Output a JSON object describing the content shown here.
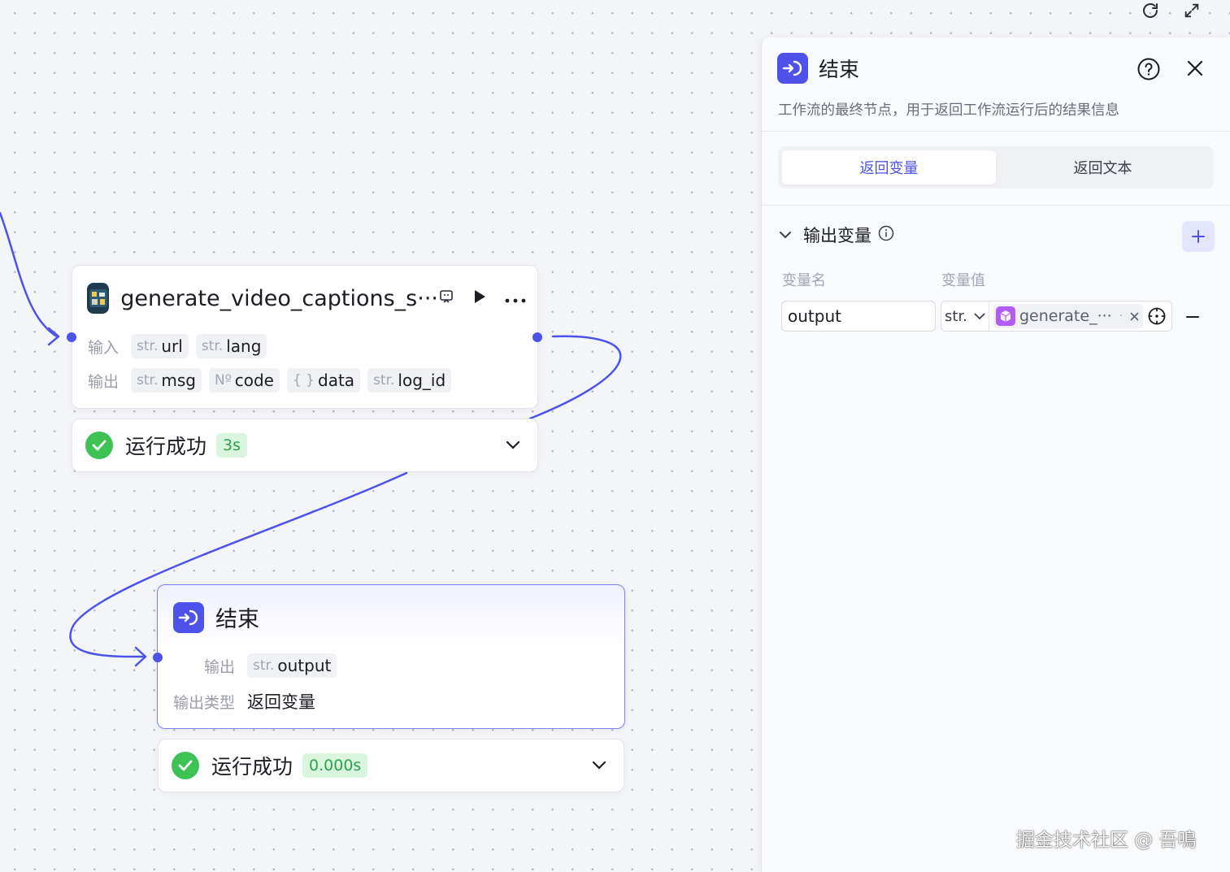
{
  "canvas": {
    "toolbar": {
      "refresh_icon": "refresh-icon",
      "expand_icon": "expand-icon"
    }
  },
  "nodes": {
    "plugin": {
      "title": "generate_video_captions_s···",
      "input_label": "输入",
      "output_label": "输出",
      "inputs": [
        {
          "type": "str.",
          "name": "url"
        },
        {
          "type": "str.",
          "name": "lang"
        }
      ],
      "outputs": [
        {
          "type": "str.",
          "name": "msg"
        },
        {
          "type": "Nº",
          "name": "code"
        },
        {
          "type": "{ }",
          "name": "data"
        },
        {
          "type": "str.",
          "name": "log_id"
        }
      ],
      "status": {
        "text": "运行成功",
        "duration": "3s"
      }
    },
    "end": {
      "title": "结束",
      "output_label": "输出",
      "outputs": [
        {
          "type": "str.",
          "name": "output"
        }
      ],
      "output_type_label": "输出类型",
      "output_type_value": "返回变量",
      "status": {
        "text": "运行成功",
        "duration": "0.000s"
      }
    }
  },
  "panel": {
    "title": "结束",
    "description": "工作流的最终节点，用于返回工作流运行后的结果信息",
    "tabs": [
      {
        "label": "返回变量",
        "active": true
      },
      {
        "label": "返回文本",
        "active": false
      }
    ],
    "section_title": "输出变量",
    "col_name": "变量名",
    "col_value": "变量值",
    "rows": [
      {
        "name": "output",
        "type": "str.",
        "ref": "generate_···"
      }
    ]
  },
  "watermark": "掘金技术社区 @ 吾鳴",
  "colors": {
    "accent": "#4d53e8",
    "success": "#3ec254",
    "success_bg": "#d9f5dd",
    "ref_icon": "#b35cf5"
  }
}
